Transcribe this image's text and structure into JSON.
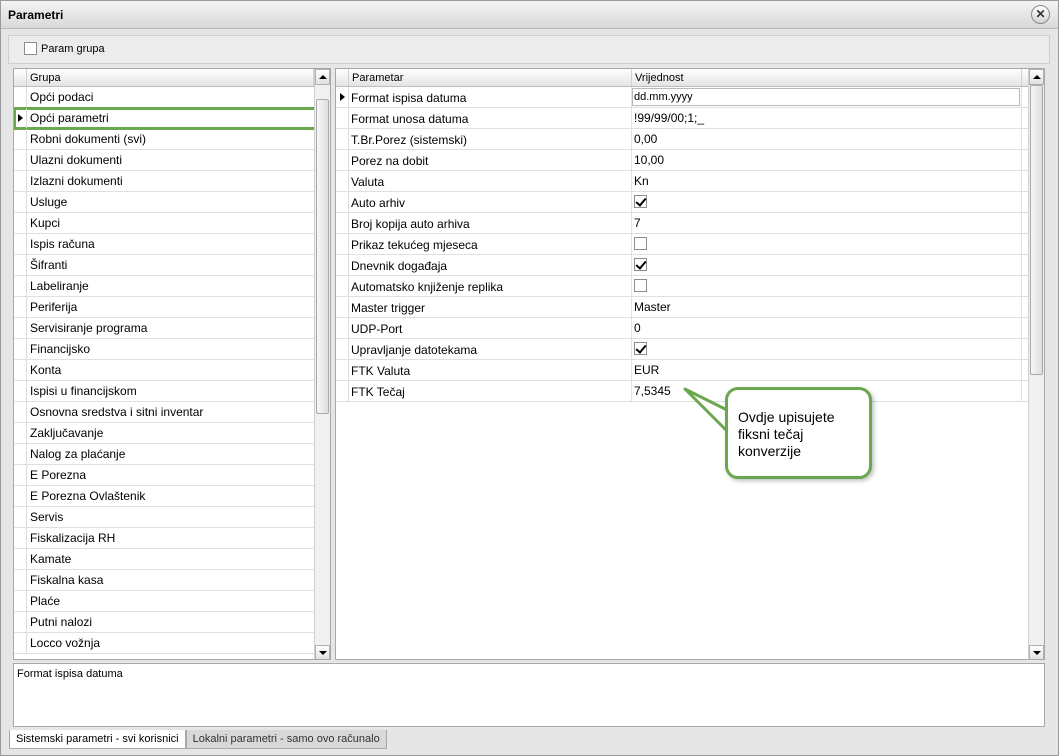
{
  "window": {
    "title": "Parametri"
  },
  "toolbar": {
    "param_grupa_label": "Param grupa",
    "param_grupa_checked": false
  },
  "left_grid": {
    "header": "Grupa",
    "items": [
      "Opći podaci",
      "Opći parametri",
      "Robni dokumenti (svi)",
      "Ulazni dokumenti",
      "Izlazni dokumenti",
      "Usluge",
      "Kupci",
      "Ispis računa",
      "Šifranti",
      "Labeliranje",
      "Periferija",
      "Servisiranje programa",
      "Financijsko",
      "Konta",
      "Ispisi u financijskom",
      "Osnovna sredstva i sitni inventar",
      "Zaključavanje",
      "Nalog za plaćanje",
      "E Porezna",
      "E Porezna Ovlaštenik",
      "Servis",
      "Fiskalizacija RH",
      "Kamate",
      "Fiskalna kasa",
      "Plaće",
      "Putni nalozi",
      "Locco vožnja"
    ],
    "selected_index": 1
  },
  "right_grid": {
    "header_param": "Parametar",
    "header_value": "Vrijednost",
    "rows": [
      {
        "name": "Format ispisa datuma",
        "value": "dd.mm.yyyy",
        "type": "input"
      },
      {
        "name": "Format unosa datuma",
        "value": "!99/99/00;1;_",
        "type": "text"
      },
      {
        "name": "T.Br.Porez (sistemski)",
        "value": "0,00",
        "type": "text"
      },
      {
        "name": "Porez na dobit",
        "value": "10,00",
        "type": "text"
      },
      {
        "name": "Valuta",
        "value": "Kn",
        "type": "text"
      },
      {
        "name": "Auto arhiv",
        "checked": true,
        "type": "checkbox"
      },
      {
        "name": "Broj kopija auto arhiva",
        "value": "7",
        "type": "text"
      },
      {
        "name": "Prikaz tekućeg mjeseca",
        "checked": false,
        "type": "checkbox"
      },
      {
        "name": "Dnevnik događaja",
        "checked": true,
        "type": "checkbox"
      },
      {
        "name": "Automatsko knjiženje replika",
        "checked": false,
        "type": "checkbox"
      },
      {
        "name": "Master trigger",
        "value": "Master",
        "type": "text"
      },
      {
        "name": "UDP-Port",
        "value": "0",
        "type": "text"
      },
      {
        "name": "Upravljanje datotekama",
        "checked": true,
        "type": "checkbox"
      },
      {
        "name": "FTK Valuta",
        "value": "EUR",
        "type": "text"
      },
      {
        "name": "FTK Tečaj",
        "value": "7,5345",
        "type": "text"
      }
    ]
  },
  "description": "Format ispisa datuma",
  "tabs": [
    "Sistemski parametri - svi korisnici",
    "Lokalni parametri - samo ovo računalo"
  ],
  "callout": {
    "lines": [
      "Ovdje upisujete",
      "fiksni tečaj",
      "konverzije"
    ]
  },
  "colors": {
    "highlight": "#6aa84f"
  }
}
